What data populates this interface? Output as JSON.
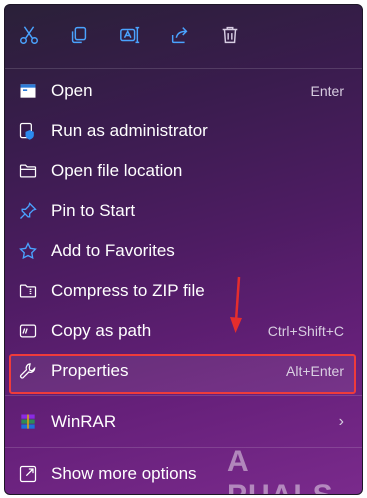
{
  "toolbar": {
    "buttons": [
      {
        "icon": "cut-icon"
      },
      {
        "icon": "copy-icon"
      },
      {
        "icon": "rename-icon"
      },
      {
        "icon": "share-icon"
      },
      {
        "icon": "delete-icon"
      }
    ]
  },
  "menu": {
    "items": [
      {
        "icon": "open-app-icon",
        "label": "Open",
        "shortcut": "Enter"
      },
      {
        "icon": "run-as-admin-icon",
        "label": "Run as administrator",
        "shortcut": ""
      },
      {
        "icon": "folder-icon",
        "label": "Open file location",
        "shortcut": ""
      },
      {
        "icon": "pin-icon",
        "label": "Pin to Start",
        "shortcut": ""
      },
      {
        "icon": "star-icon",
        "label": "Add to Favorites",
        "shortcut": ""
      },
      {
        "icon": "zip-folder-icon",
        "label": "Compress to ZIP file",
        "shortcut": ""
      },
      {
        "icon": "copy-path-icon",
        "label": "Copy as path",
        "shortcut": "Ctrl+Shift+C"
      },
      {
        "icon": "wrench-icon",
        "label": "Properties",
        "shortcut": "Alt+Enter"
      },
      {
        "icon": "winrar-icon",
        "label": "WinRAR",
        "shortcut": ""
      },
      {
        "icon": "show-more-icon",
        "label": "Show more options",
        "shortcut": ""
      }
    ]
  },
  "watermark": "A  PUALS",
  "colors": {
    "accent": "#4aa3ff",
    "highlight": "#ef3b3b",
    "text": "#ffffff"
  }
}
